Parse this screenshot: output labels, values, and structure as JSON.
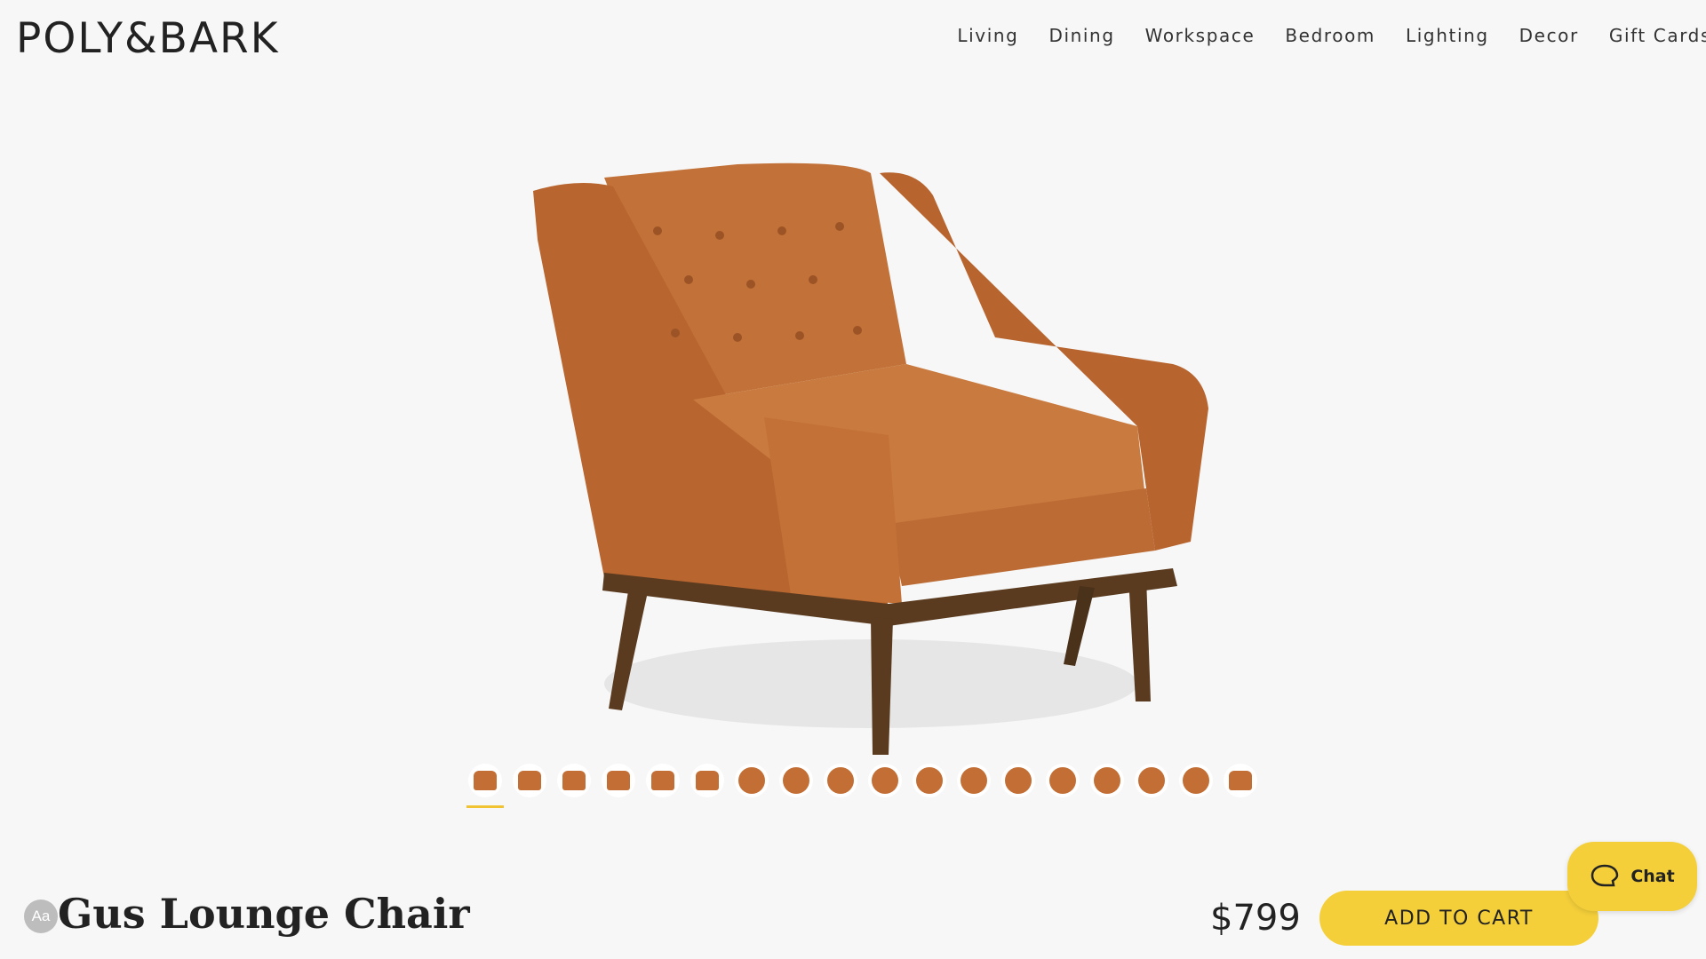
{
  "brand": {
    "logo": "POLY&BARK"
  },
  "nav": [
    "Living",
    "Dining",
    "Workspace",
    "Bedroom",
    "Lighting",
    "Decor",
    "Gift Cards"
  ],
  "product": {
    "title": "Gus Lounge Chair",
    "price": "$799",
    "add_to_cart": "ADD TO CART",
    "image_alt_icon": "lounge-chair-image"
  },
  "gallery": {
    "thumbnail_count": 18,
    "active_index": 0
  },
  "accessibility": {
    "label": "Aa"
  },
  "chat": {
    "label": "Chat"
  },
  "colors": {
    "accent": "#f4cf3a",
    "leather": "#c36e34",
    "legs": "#5a3b1f",
    "background": "#f7f7f7"
  }
}
